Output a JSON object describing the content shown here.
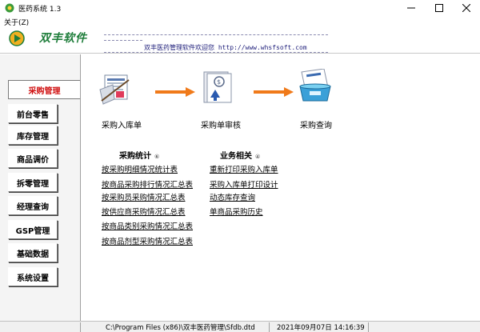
{
  "window": {
    "title": "医药系统 1.3",
    "min_glyph": "—",
    "max_glyph": "☐",
    "close_glyph": "✕"
  },
  "menu": {
    "items": [
      {
        "label": "关于(Z)"
      }
    ]
  },
  "banner": {
    "logo_text": "双丰软件",
    "slogan": "双丰医药管理软件欢迎您 http://www.whsfsoft.com"
  },
  "sidebar": {
    "items": [
      {
        "label": "采购管理",
        "active": true
      },
      {
        "label": "前台零售"
      },
      {
        "label": "库存管理"
      },
      {
        "label": "商品调价"
      },
      {
        "label": "拆零管理"
      },
      {
        "label": "经理查询"
      },
      {
        "label": "GSP管理"
      },
      {
        "label": "基础数据"
      },
      {
        "label": "系统设置"
      }
    ]
  },
  "process": {
    "steps": [
      {
        "label": "采购入库单",
        "icon": "purchase-receipt-icon"
      },
      {
        "label": "采购单审核",
        "icon": "purchase-review-icon"
      },
      {
        "label": "采购查询",
        "icon": "purchase-query-icon"
      }
    ]
  },
  "stats": {
    "title": "采购统计",
    "count": "⑥",
    "links": [
      "按采购明细情况统计表",
      "按商品采购排行情况汇总表",
      "按采购员采购情况汇总表",
      "按供应商采购情况汇总表",
      "按商品类别采购情况汇总表",
      "按商品剂型采购情况汇总表"
    ]
  },
  "business": {
    "title": "业务相关",
    "count": "④",
    "links": [
      "重新打印采购入库单",
      "采购入库单打印设计",
      "动态库存查询",
      "单商品采购历史"
    ]
  },
  "status": {
    "path": "C:\\Program Files (x86)\\双丰医药管理\\Sfdb.dtd",
    "datetime": "2021年09月07日  14:16:39"
  },
  "colors": {
    "accent_red": "#d01010",
    "logo_green": "#1e7d3a",
    "arrow_orange": "#f07a1a"
  }
}
